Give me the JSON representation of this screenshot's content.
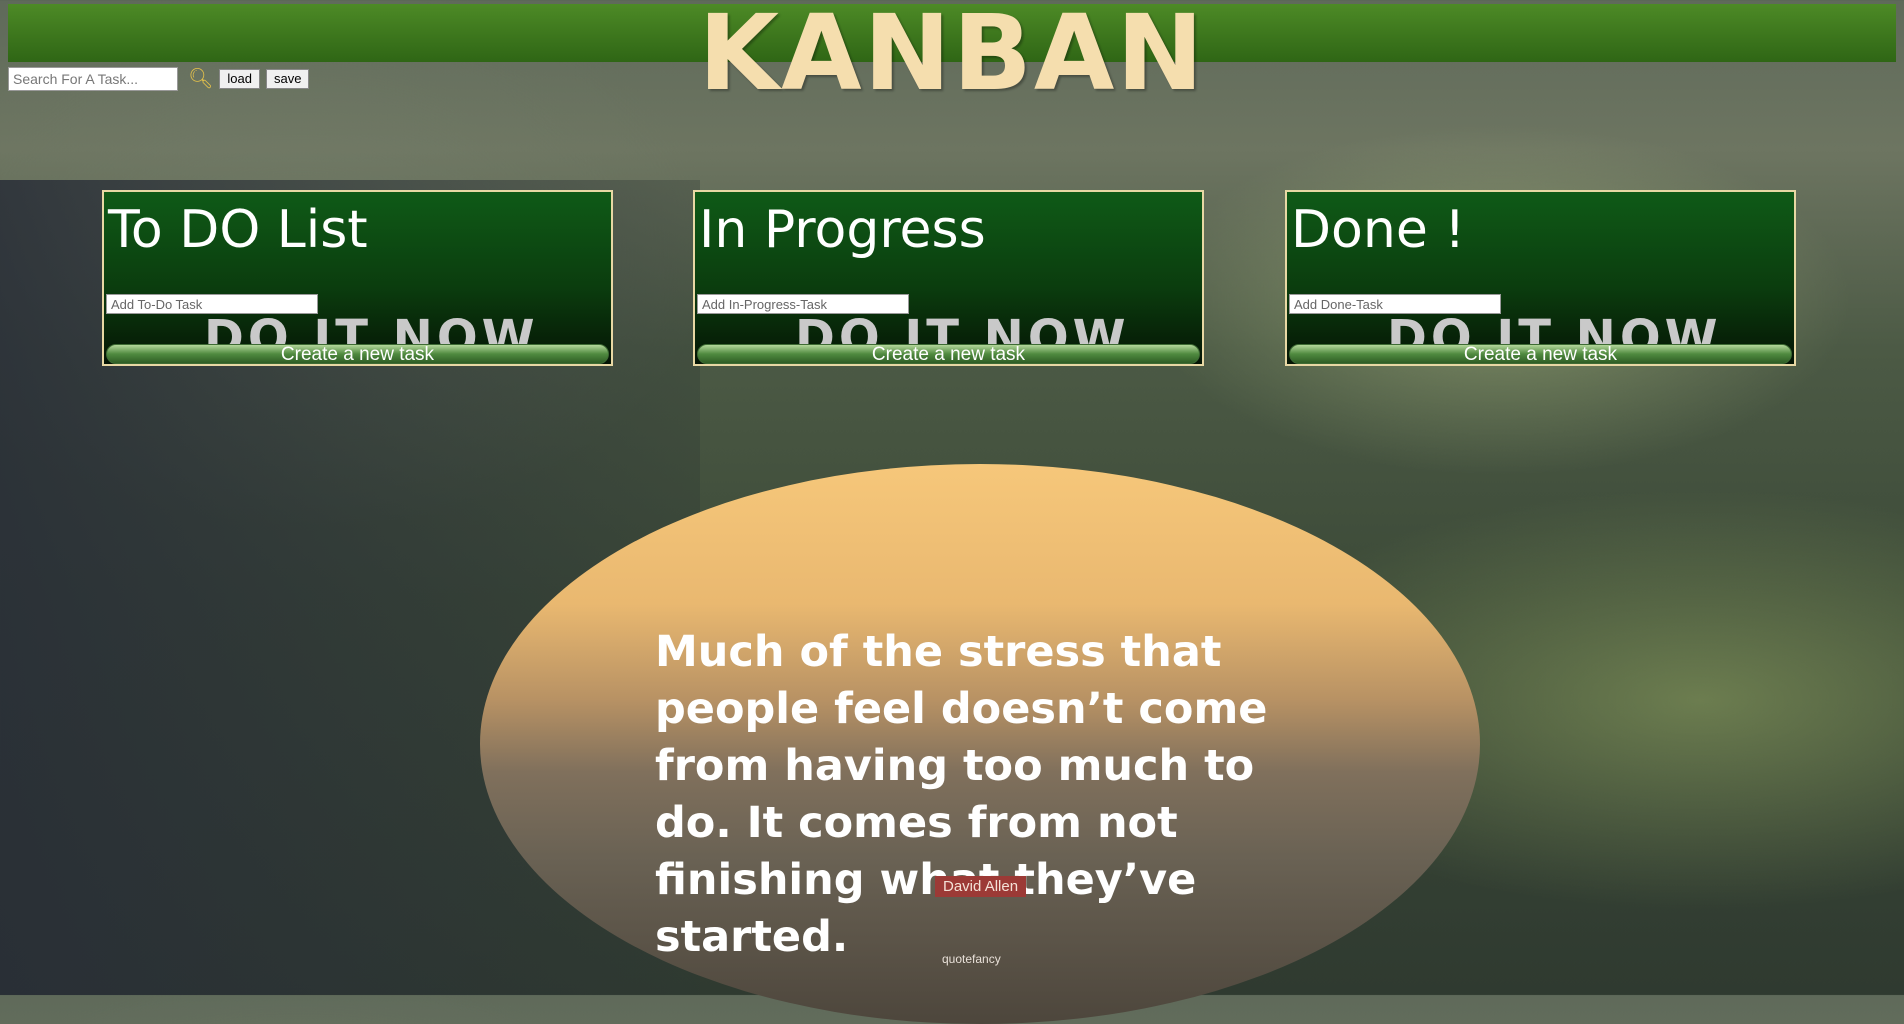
{
  "header": {
    "title": "KANBAN"
  },
  "toolbar": {
    "search_placeholder": "Search For A Task...",
    "search_icon": "search-icon",
    "load_label": "load",
    "save_label": "save"
  },
  "columns": [
    {
      "title": "To DO List",
      "input_placeholder": "Add To-Do Task",
      "watermark": "DO IT NOW",
      "button_label": "Create a new task"
    },
    {
      "title": "In Progress",
      "input_placeholder": "Add In-Progress-Task",
      "watermark": "DO IT NOW",
      "button_label": "Create a new task"
    },
    {
      "title": "Done !",
      "input_placeholder": "Add Done-Task",
      "watermark": "DO IT NOW",
      "button_label": "Create a new task"
    }
  ],
  "quote": {
    "text": "Much of the stress that people feel doesn’t come from having too much to do. It comes from not finishing what they’ve started.",
    "author": "David Allen",
    "brand": "quotefancy"
  },
  "colors": {
    "header_green": "#3f7d1f",
    "title_color": "#f5deae",
    "column_border": "#e8d8a4"
  }
}
